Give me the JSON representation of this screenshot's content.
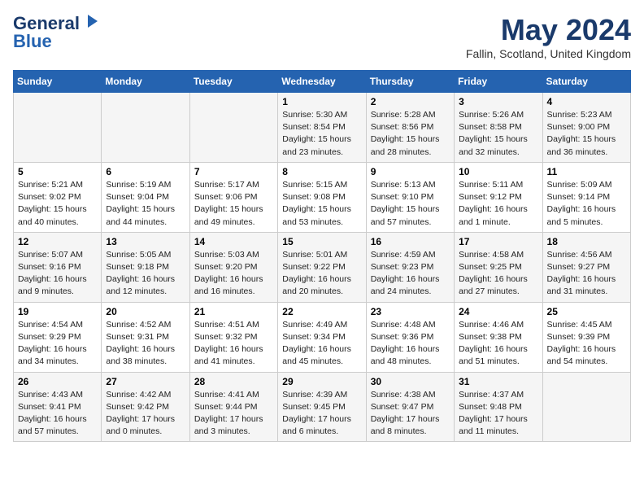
{
  "logo": {
    "line1": "General",
    "line2": "Blue"
  },
  "header": {
    "title": "May 2024",
    "subtitle": "Fallin, Scotland, United Kingdom"
  },
  "weekdays": [
    "Sunday",
    "Monday",
    "Tuesday",
    "Wednesday",
    "Thursday",
    "Friday",
    "Saturday"
  ],
  "weeks": [
    [
      {
        "day": "",
        "info": ""
      },
      {
        "day": "",
        "info": ""
      },
      {
        "day": "",
        "info": ""
      },
      {
        "day": "1",
        "info": "Sunrise: 5:30 AM\nSunset: 8:54 PM\nDaylight: 15 hours\nand 23 minutes."
      },
      {
        "day": "2",
        "info": "Sunrise: 5:28 AM\nSunset: 8:56 PM\nDaylight: 15 hours\nand 28 minutes."
      },
      {
        "day": "3",
        "info": "Sunrise: 5:26 AM\nSunset: 8:58 PM\nDaylight: 15 hours\nand 32 minutes."
      },
      {
        "day": "4",
        "info": "Sunrise: 5:23 AM\nSunset: 9:00 PM\nDaylight: 15 hours\nand 36 minutes."
      }
    ],
    [
      {
        "day": "5",
        "info": "Sunrise: 5:21 AM\nSunset: 9:02 PM\nDaylight: 15 hours\nand 40 minutes."
      },
      {
        "day": "6",
        "info": "Sunrise: 5:19 AM\nSunset: 9:04 PM\nDaylight: 15 hours\nand 44 minutes."
      },
      {
        "day": "7",
        "info": "Sunrise: 5:17 AM\nSunset: 9:06 PM\nDaylight: 15 hours\nand 49 minutes."
      },
      {
        "day": "8",
        "info": "Sunrise: 5:15 AM\nSunset: 9:08 PM\nDaylight: 15 hours\nand 53 minutes."
      },
      {
        "day": "9",
        "info": "Sunrise: 5:13 AM\nSunset: 9:10 PM\nDaylight: 15 hours\nand 57 minutes."
      },
      {
        "day": "10",
        "info": "Sunrise: 5:11 AM\nSunset: 9:12 PM\nDaylight: 16 hours\nand 1 minute."
      },
      {
        "day": "11",
        "info": "Sunrise: 5:09 AM\nSunset: 9:14 PM\nDaylight: 16 hours\nand 5 minutes."
      }
    ],
    [
      {
        "day": "12",
        "info": "Sunrise: 5:07 AM\nSunset: 9:16 PM\nDaylight: 16 hours\nand 9 minutes."
      },
      {
        "day": "13",
        "info": "Sunrise: 5:05 AM\nSunset: 9:18 PM\nDaylight: 16 hours\nand 12 minutes."
      },
      {
        "day": "14",
        "info": "Sunrise: 5:03 AM\nSunset: 9:20 PM\nDaylight: 16 hours\nand 16 minutes."
      },
      {
        "day": "15",
        "info": "Sunrise: 5:01 AM\nSunset: 9:22 PM\nDaylight: 16 hours\nand 20 minutes."
      },
      {
        "day": "16",
        "info": "Sunrise: 4:59 AM\nSunset: 9:23 PM\nDaylight: 16 hours\nand 24 minutes."
      },
      {
        "day": "17",
        "info": "Sunrise: 4:58 AM\nSunset: 9:25 PM\nDaylight: 16 hours\nand 27 minutes."
      },
      {
        "day": "18",
        "info": "Sunrise: 4:56 AM\nSunset: 9:27 PM\nDaylight: 16 hours\nand 31 minutes."
      }
    ],
    [
      {
        "day": "19",
        "info": "Sunrise: 4:54 AM\nSunset: 9:29 PM\nDaylight: 16 hours\nand 34 minutes."
      },
      {
        "day": "20",
        "info": "Sunrise: 4:52 AM\nSunset: 9:31 PM\nDaylight: 16 hours\nand 38 minutes."
      },
      {
        "day": "21",
        "info": "Sunrise: 4:51 AM\nSunset: 9:32 PM\nDaylight: 16 hours\nand 41 minutes."
      },
      {
        "day": "22",
        "info": "Sunrise: 4:49 AM\nSunset: 9:34 PM\nDaylight: 16 hours\nand 45 minutes."
      },
      {
        "day": "23",
        "info": "Sunrise: 4:48 AM\nSunset: 9:36 PM\nDaylight: 16 hours\nand 48 minutes."
      },
      {
        "day": "24",
        "info": "Sunrise: 4:46 AM\nSunset: 9:38 PM\nDaylight: 16 hours\nand 51 minutes."
      },
      {
        "day": "25",
        "info": "Sunrise: 4:45 AM\nSunset: 9:39 PM\nDaylight: 16 hours\nand 54 minutes."
      }
    ],
    [
      {
        "day": "26",
        "info": "Sunrise: 4:43 AM\nSunset: 9:41 PM\nDaylight: 16 hours\nand 57 minutes."
      },
      {
        "day": "27",
        "info": "Sunrise: 4:42 AM\nSunset: 9:42 PM\nDaylight: 17 hours\nand 0 minutes."
      },
      {
        "day": "28",
        "info": "Sunrise: 4:41 AM\nSunset: 9:44 PM\nDaylight: 17 hours\nand 3 minutes."
      },
      {
        "day": "29",
        "info": "Sunrise: 4:39 AM\nSunset: 9:45 PM\nDaylight: 17 hours\nand 6 minutes."
      },
      {
        "day": "30",
        "info": "Sunrise: 4:38 AM\nSunset: 9:47 PM\nDaylight: 17 hours\nand 8 minutes."
      },
      {
        "day": "31",
        "info": "Sunrise: 4:37 AM\nSunset: 9:48 PM\nDaylight: 17 hours\nand 11 minutes."
      },
      {
        "day": "",
        "info": ""
      }
    ]
  ]
}
